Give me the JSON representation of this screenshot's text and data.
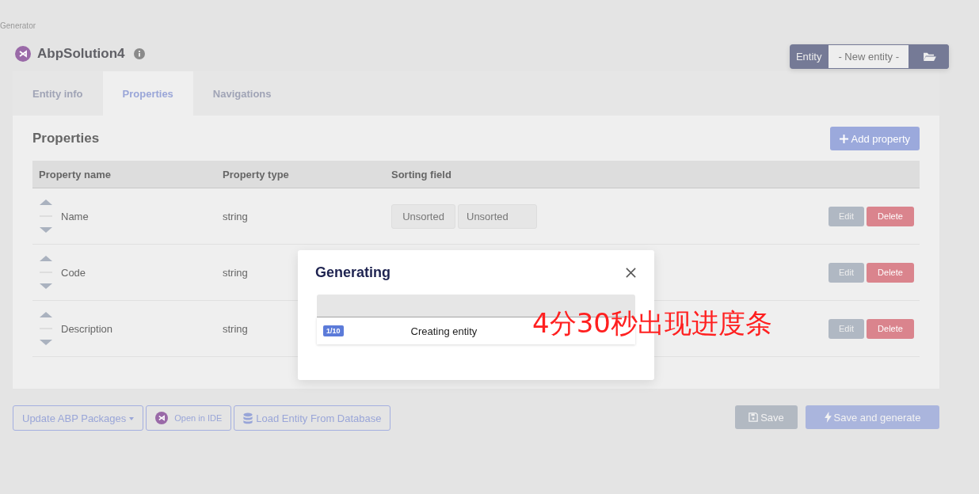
{
  "breadcrumb": "Generator",
  "solution": {
    "title": "AbpSolution4"
  },
  "entity_picker": {
    "label": "Entity",
    "value": "- New entity -"
  },
  "tabs": [
    {
      "label": "Entity info",
      "selected": false
    },
    {
      "label": "Properties",
      "selected": true
    },
    {
      "label": "Navigations",
      "selected": false
    }
  ],
  "properties_panel": {
    "heading": "Properties",
    "add_button": "Add property",
    "columns": [
      "Property name",
      "Property type",
      "Sorting field"
    ],
    "rows": [
      {
        "name": "Name",
        "type": "string",
        "sorting": [
          "Unsorted",
          "Unsorted"
        ],
        "edit": "Edit",
        "delete": "Delete"
      },
      {
        "name": "Code",
        "type": "string",
        "edit": "Edit",
        "delete": "Delete"
      },
      {
        "name": "Description",
        "type": "string",
        "edit": "Edit",
        "delete": "Delete"
      }
    ]
  },
  "footer": {
    "update_packages": "Update ABP Packages",
    "open_ide": "Open in IDE",
    "load_entity": "Load Entity From Database",
    "save": {
      "label": "Save",
      "disabled": true
    },
    "save_generate": {
      "label": "Save and generate",
      "disabled": true
    }
  },
  "dialog": {
    "title": "Generating",
    "progress": {
      "level": 0
    },
    "steps": [
      {
        "badge": "1/10",
        "label": "Creating entity"
      }
    ]
  },
  "annotation": "4分30秒出现进度条"
}
